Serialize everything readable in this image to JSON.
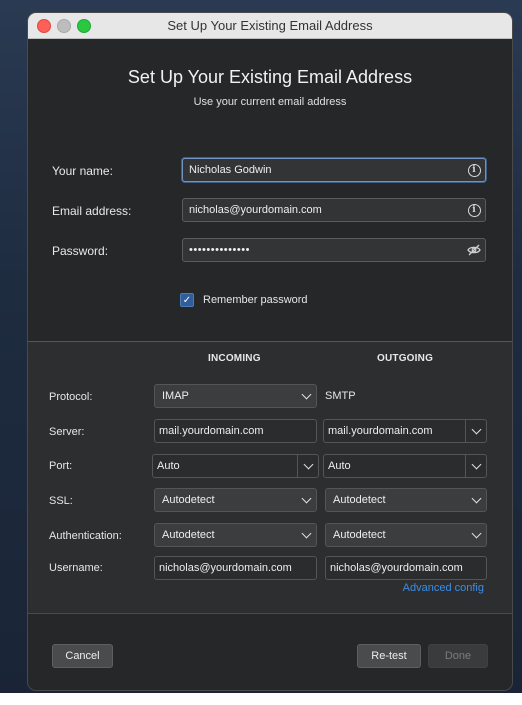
{
  "window": {
    "title": "Set Up Your Existing Email Address"
  },
  "header": {
    "heading": "Set Up Your Existing Email Address",
    "subheading": "Use your current email address"
  },
  "form": {
    "name_label": "Your name:",
    "name_value": "Nicholas Godwin",
    "email_label": "Email address:",
    "email_value": "nicholas@yourdomain.com",
    "password_label": "Password:",
    "password_value": "••••••••••••••",
    "remember_label": "Remember password",
    "remember_checked": true
  },
  "server": {
    "incoming_header": "INCOMING",
    "outgoing_header": "OUTGOING",
    "labels": {
      "protocol": "Protocol:",
      "server": "Server:",
      "port": "Port:",
      "ssl": "SSL:",
      "authentication": "Authentication:",
      "username": "Username:"
    },
    "incoming": {
      "protocol": "IMAP",
      "server": "mail.yourdomain.com",
      "port": "Auto",
      "ssl": "Autodetect",
      "authentication": "Autodetect",
      "username": "nicholas@yourdomain.com"
    },
    "outgoing": {
      "protocol": "SMTP",
      "server": "mail.yourdomain.com",
      "port": "Auto",
      "ssl": "Autodetect",
      "authentication": "Autodetect",
      "username": "nicholas@yourdomain.com"
    },
    "advanced_link": "Advanced config"
  },
  "footer": {
    "cancel_label": "Cancel",
    "retest_label": "Re-test",
    "done_label": "Done"
  },
  "colors": {
    "accent": "#3a8ee6",
    "checkbox": "#2f5e9a",
    "window_bg": "#262728"
  }
}
